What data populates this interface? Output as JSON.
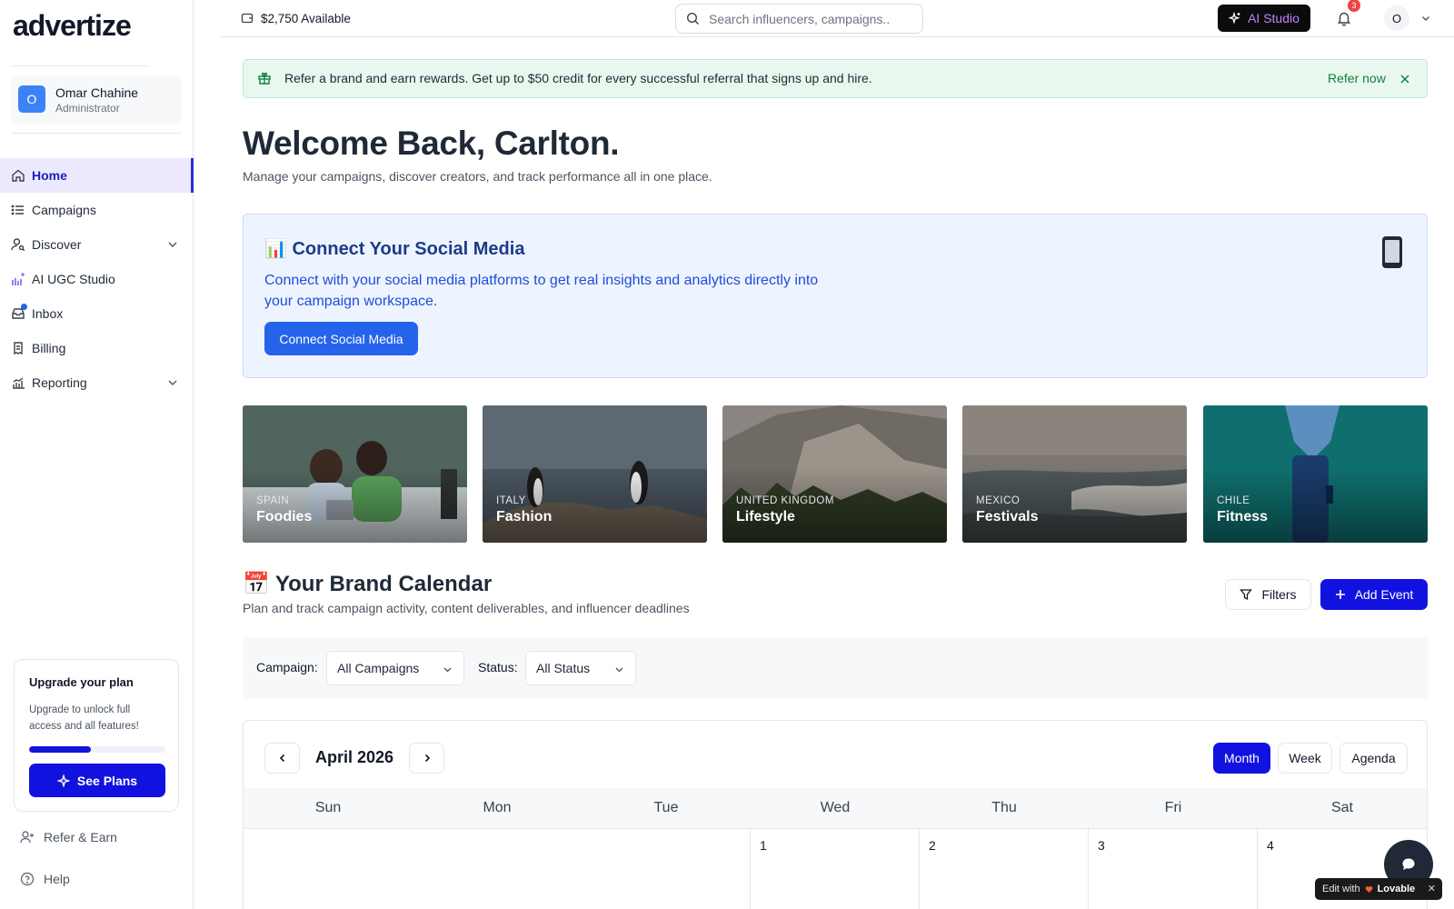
{
  "brand": {
    "logo_text": "advertize"
  },
  "user": {
    "avatar_initial": "O",
    "name": "Omar Chahine",
    "role": "Administrator"
  },
  "sidebar": {
    "items": [
      {
        "label": "Home",
        "icon": "home-icon",
        "active": true
      },
      {
        "label": "Campaigns",
        "icon": "list-icon"
      },
      {
        "label": "Discover",
        "icon": "user-search-icon",
        "has_chevron": true
      },
      {
        "label": "AI UGC Studio",
        "icon": "ai-sparkle-bars-icon"
      },
      {
        "label": "Inbox",
        "icon": "inbox-icon",
        "has_dot": true
      },
      {
        "label": "Billing",
        "icon": "billing-icon"
      },
      {
        "label": "Reporting",
        "icon": "chart-icon",
        "has_chevron": true
      }
    ],
    "upgrade": {
      "title": "Upgrade your plan",
      "text": "Upgrade to unlock full access and all features!",
      "progress": 0.45,
      "button_label": "See Plans"
    },
    "refer_label": "Refer & Earn",
    "help_label": "Help"
  },
  "topbar": {
    "balance": "$2,750 Available",
    "search_placeholder": "Search influencers, campaigns..",
    "ai_studio_label": "AI Studio",
    "notification_count": "3",
    "profile_initial": "O"
  },
  "referral_banner": {
    "text": "Refer a brand and earn rewards. Get up to $50 credit for every successful referral that signs up and hire.",
    "action_label": "Refer now"
  },
  "welcome": {
    "title": "Welcome Back, Carlton.",
    "subtitle": "Manage your campaigns, discover creators, and track performance all in one place."
  },
  "connect_card": {
    "title": "Connect Your Social Media",
    "title_emoji": "📊",
    "text": "Connect with your social media platforms to get real insights and analytics directly into your campaign workspace.",
    "button_label": "Connect Social Media"
  },
  "categories": [
    {
      "country": "SPAIN",
      "category": "Foodies"
    },
    {
      "country": "ITALY",
      "category": "Fashion"
    },
    {
      "country": "UNITED KINGDOM",
      "category": "Lifestyle"
    },
    {
      "country": "MEXICO",
      "category": "Festivals"
    },
    {
      "country": "CHILE",
      "category": "Fitness"
    }
  ],
  "calendar": {
    "title": "Your Brand Calendar",
    "title_emoji": "📅",
    "subtitle": "Plan and track campaign activity, content deliverables, and influencer deadlines",
    "filters_label": "Filters",
    "add_event_label": "Add Event",
    "campaign_label": "Campaign:",
    "campaign_value": "All Campaigns",
    "status_label": "Status:",
    "status_value": "All Status",
    "month": "April 2026",
    "views": [
      "Month",
      "Week",
      "Agenda"
    ],
    "active_view": "Month",
    "weekdays": [
      "Sun",
      "Mon",
      "Tue",
      "Wed",
      "Thu",
      "Fri",
      "Sat"
    ],
    "first_row_days": [
      "",
      "",
      "",
      "1",
      "2",
      "3",
      "4"
    ]
  },
  "footer_badge": {
    "prefix": "Edit with",
    "name": "Lovable",
    "close": "✕"
  },
  "colors": {
    "accent": "#1212e0",
    "active_nav_bg": "#ece9ff",
    "referral_bg": "#e9f8ef",
    "connect_bg": "#eef4ff"
  }
}
